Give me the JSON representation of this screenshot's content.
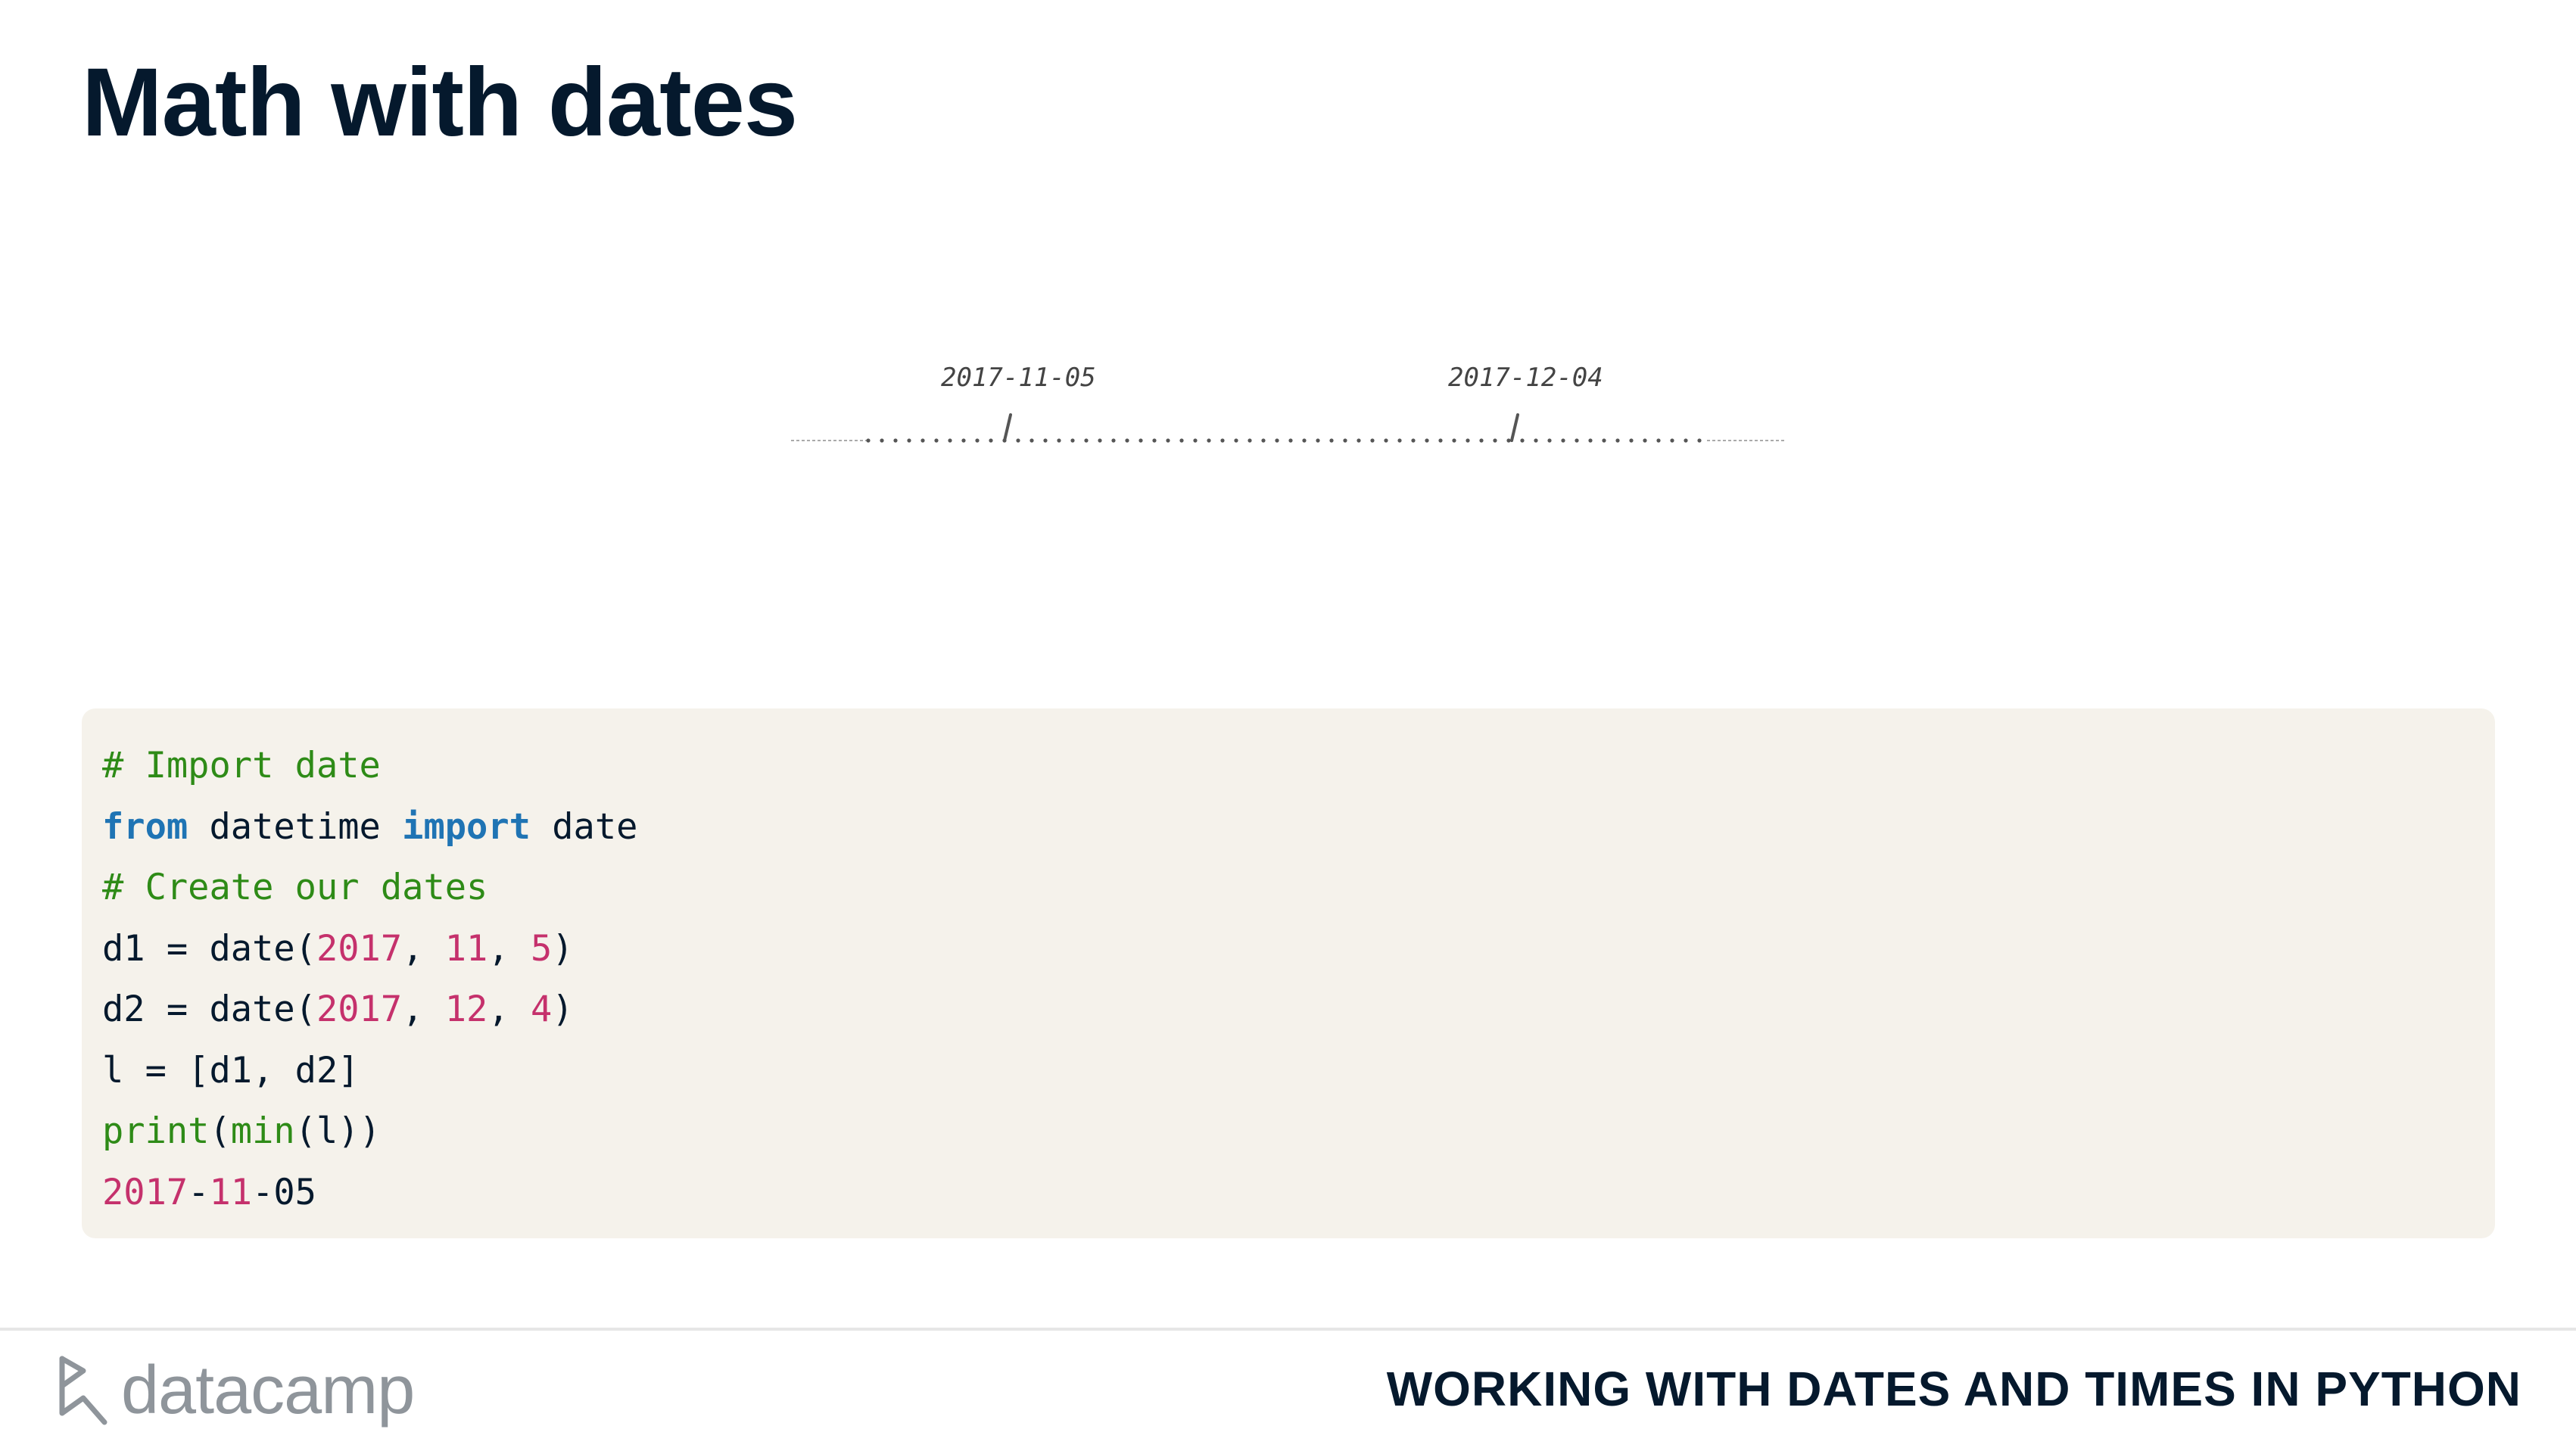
{
  "slide": {
    "title": "Math with dates"
  },
  "timeline": {
    "labels": [
      "2017-11-05",
      "2017-12-04"
    ]
  },
  "code": {
    "lines": [
      [
        {
          "t": "# Import date",
          "k": "comment"
        }
      ],
      [
        {
          "t": "from",
          "k": "kw"
        },
        {
          "t": " datetime ",
          "k": "plain"
        },
        {
          "t": "import",
          "k": "kw"
        },
        {
          "t": " date",
          "k": "plain"
        }
      ],
      [
        {
          "t": "# Create our dates",
          "k": "comment"
        }
      ],
      [
        {
          "t": "d1 = date(",
          "k": "plain"
        },
        {
          "t": "2017",
          "k": "num"
        },
        {
          "t": ", ",
          "k": "plain"
        },
        {
          "t": "11",
          "k": "num"
        },
        {
          "t": ", ",
          "k": "plain"
        },
        {
          "t": "5",
          "k": "num"
        },
        {
          "t": ")",
          "k": "plain"
        }
      ],
      [
        {
          "t": "d2 = date(",
          "k": "plain"
        },
        {
          "t": "2017",
          "k": "num"
        },
        {
          "t": ", ",
          "k": "plain"
        },
        {
          "t": "12",
          "k": "num"
        },
        {
          "t": ", ",
          "k": "plain"
        },
        {
          "t": "4",
          "k": "num"
        },
        {
          "t": ")",
          "k": "plain"
        }
      ],
      [
        {
          "t": "l = [d1, d2]",
          "k": "plain"
        }
      ],
      [
        {
          "t": "print",
          "k": "builtin"
        },
        {
          "t": "(",
          "k": "plain"
        },
        {
          "t": "min",
          "k": "builtin"
        },
        {
          "t": "(l))",
          "k": "plain"
        }
      ],
      [
        {
          "t": "2017",
          "k": "num"
        },
        {
          "t": "-",
          "k": "plain"
        },
        {
          "t": "11",
          "k": "num"
        },
        {
          "t": "-05",
          "k": "plain"
        }
      ]
    ]
  },
  "footer": {
    "brand": "datacamp",
    "course_title": "WORKING WITH DATES AND TIMES IN PYTHON"
  },
  "colors": {
    "title": "#05192d",
    "comment": "#2e8b17",
    "keyword": "#1f74b4",
    "number": "#c5316c",
    "code_bg": "#f5f2eb"
  }
}
